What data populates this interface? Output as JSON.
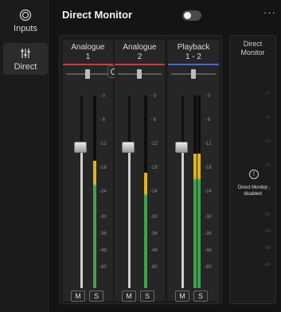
{
  "sidebar": {
    "items": [
      {
        "label": "Inputs",
        "icon": "inputs-icon"
      },
      {
        "label": "Direct",
        "icon": "mixer-sliders-icon",
        "selected": true
      }
    ]
  },
  "header": {
    "title": "Direct Monitor",
    "toggle_on": false,
    "more_label": "···"
  },
  "channels": [
    {
      "name_line1": "Analogue",
      "name_line2": "1",
      "underline": "#d43a3a",
      "fader": 0.73,
      "meter": 0.66,
      "mute": "M",
      "solo": "S"
    },
    {
      "name_line1": "Analogue",
      "name_line2": "2",
      "underline": "#d43a3a",
      "fader": 0.73,
      "meter": 0.6,
      "mute": "M",
      "solo": "S"
    },
    {
      "name_line1": "Playback",
      "name_line2": "1 - 2",
      "underline": "#3e6fd8",
      "fader": 0.73,
      "meter": 0.7,
      "mute": "M",
      "solo": "S"
    }
  ],
  "scale_labels": [
    "0",
    "6",
    "12",
    "18",
    "24",
    "30",
    "36",
    "48",
    "60"
  ],
  "scale_labels_signed": [
    "- 0",
    "- 6",
    "-12",
    "-18",
    "-24",
    "-30",
    "-36",
    "-48",
    "-60"
  ],
  "direct_monitor_panel": {
    "title_line1": "Direct",
    "title_line2": "Monitor",
    "status_icon": "alert-circle-icon",
    "status_line1": "Direct Monitor",
    "status_line2": "disabled"
  },
  "colors": {
    "background": "#141414",
    "meter_green": "#3fa34d",
    "meter_yellow": "#e0b21d",
    "input_underline": "#d43a3a",
    "playback_underline": "#3e6fd8"
  }
}
